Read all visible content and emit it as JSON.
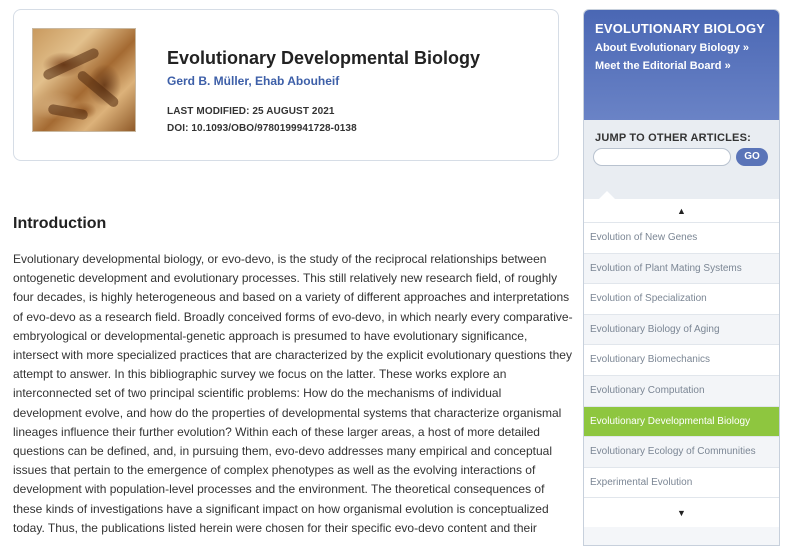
{
  "article": {
    "title": "Evolutionary Developmental Biology",
    "authors": [
      "Gerd B. Müller",
      "Ehab Abouheif"
    ],
    "author_separator": ", ",
    "last_modified": "LAST MODIFIED: 25 AUGUST 2021",
    "doi": "DOI: 10.1093/OBO/9780199941728-0138"
  },
  "introduction": {
    "heading": "Introduction",
    "body": "Evolutionary developmental biology, or evo-devo, is the study of the reciprocal relationships between ontogenetic development and evolutionary processes. This still relatively new research field, of roughly four decades, is highly heterogeneous and based on a variety of different approaches and interpretations of evo-devo as a research field. Broadly conceived forms of evo-devo, in which nearly every comparative-embryological or developmental-genetic approach is presumed to have evolutionary significance, intersect with more specialized practices that are characterized by the explicit evolutionary questions they attempt to answer. In this bibliographic survey we focus on the latter. These works explore an interconnected set of two principal scientific problems: How do the mechanisms of individual development evolve, and how do the properties of developmental systems that characterize organismal lineages influence their further evolution? Within each of these larger areas, a host of more detailed questions can be defined, and, in pursuing them, evo-devo addresses many empirical and conceptual issues that pertain to the emergence of complex phenotypes as well as the evolving interactions of development with population-level processes and the environment. The theoretical consequences of these kinds of investigations have a significant impact on how organismal evolution is conceptualized today. Thus, the publications listed herein were chosen for their specific evo-devo content and their"
  },
  "sidebar": {
    "title": "EVOLUTIONARY BIOLOGY",
    "links": [
      "About Evolutionary Biology »",
      "Meet the Editorial Board »"
    ],
    "jump_label": "JUMP TO OTHER ARTICLES:",
    "jump_placeholder": "",
    "go_label": "GO",
    "up_arrow": "▲",
    "down_arrow": "▼",
    "articles": [
      "Evolution of New Genes",
      "Evolution of Plant Mating Systems",
      "Evolution of Specialization",
      "Evolutionary Biology of Aging",
      "Evolutionary Biomechanics",
      "Evolutionary Computation",
      "Evolutionary Developmental Biology",
      "Evolutionary Ecology of Communities",
      "Experimental Evolution"
    ],
    "active_article": "Evolutionary Developmental Biology"
  },
  "colors": {
    "sidebar_header": "#4a67b4",
    "active_item": "#8ec63f",
    "author_link": "#3d5fa8"
  },
  "icons": {
    "up": "chevron-up-icon",
    "down": "chevron-down-icon"
  }
}
